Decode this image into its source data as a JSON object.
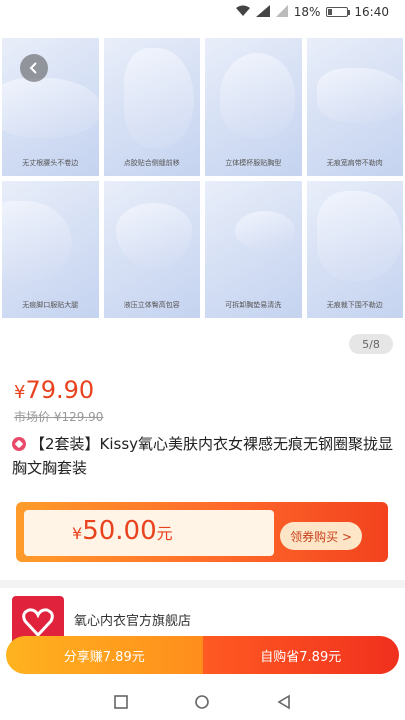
{
  "status_bar": {
    "battery": "18%",
    "time": "16:40",
    "battery_level": 0.18
  },
  "gallery": {
    "captions": [
      "无丈根腰头不卷边",
      "点胶贴合侧缝前移",
      "立体模杯服贴胸型",
      "无痕宽肩带不勒肉",
      "无痕脚口服贴大腿",
      "液压立体臀高包容",
      "可拆卸胸垫易清洗",
      "无痕裁下围不勒边"
    ],
    "page_indicator": "5/8"
  },
  "product": {
    "price_symbol": "¥",
    "price": "79.90",
    "original_price": "市场价 ¥129.90",
    "title": "【2套装】Kissy氧心美肤内衣女裸感无痕无钢圈聚拢显胸文胸套装"
  },
  "coupon": {
    "symbol": "¥",
    "amount": "50.00",
    "unit": "元",
    "button": "领券购买 >"
  },
  "shop": {
    "name": "氧心内衣官方旗舰店"
  },
  "actions": {
    "share": "分享赚7.89元",
    "buy": "自购省7.89元"
  },
  "colors": {
    "accent": "#e8431e",
    "share_orange": "#ff9f1f",
    "buy_red": "#f2361f"
  }
}
